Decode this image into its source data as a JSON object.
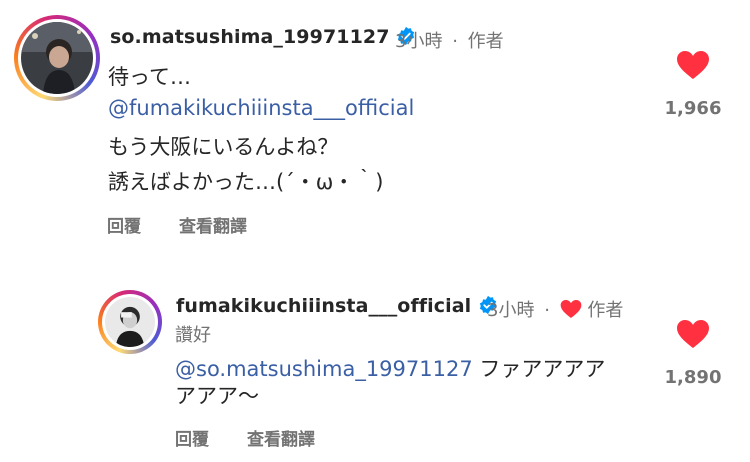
{
  "comments": [
    {
      "username": "so.matsushima_19971127",
      "time": "3小時",
      "dot": "·",
      "author_badge": "作者",
      "lines": [
        "待って…",
        "@fumakikuchiiinsta___official",
        "もう大阪にいるんよね？",
        "誘えばよかった…(´・ω・｀)"
      ],
      "reply_label": "回覆",
      "translate_label": "查看翻譯",
      "likes": "1,966"
    },
    {
      "username": "fumakikuchiiinsta___official",
      "time": "3小時",
      "dot": "·",
      "author_badge": "作者",
      "liked_by_author_label": "讚好",
      "mention": "@so.matsushima_19971127",
      "line1_rest": " ファアアアア",
      "line2": "アアア～",
      "reply_label": "回覆",
      "translate_label": "查看翻譯",
      "likes": "1,890"
    }
  ],
  "colors": {
    "heart": "#ff3040",
    "verified": "#0095f6",
    "mention": "#3b5fa5",
    "meta": "#737373"
  }
}
